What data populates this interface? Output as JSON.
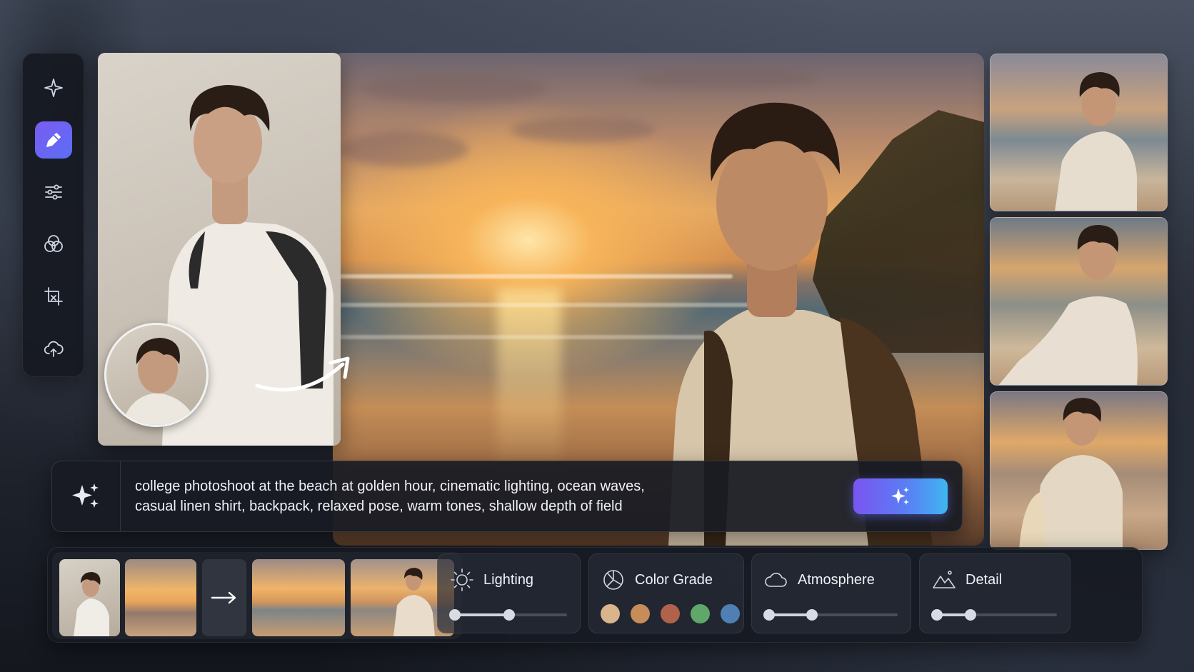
{
  "sidebar": {
    "tools": [
      {
        "name": "sparkle",
        "active": false
      },
      {
        "name": "pencil",
        "active": true
      },
      {
        "name": "sliders",
        "active": false
      },
      {
        "name": "color-circles",
        "active": false
      },
      {
        "name": "crop",
        "active": false
      },
      {
        "name": "cloud-upload",
        "active": false
      }
    ]
  },
  "prompt": {
    "line1": "college photoshoot at the beach at golden hour, cinematic lighting, ocean waves,",
    "line2": "casual linen shirt, backpack, relaxed pose, warm tones, shallow depth of field"
  },
  "controls": {
    "lighting": {
      "label": "Lighting",
      "value": 0.49
    },
    "color_grade": {
      "label": "Color Grade",
      "swatches": [
        "#d9b48c",
        "#c68c59",
        "#b0624a",
        "#5fa86a",
        "#4f7fb3"
      ]
    },
    "atmosphere": {
      "label": "Atmosphere",
      "value": 0.34
    },
    "detail": {
      "label": "Detail",
      "value": 0.29
    }
  },
  "colors": {
    "accent_start": "#7a55f0",
    "accent_end": "#3fb6f0",
    "panel": "#181b24"
  }
}
